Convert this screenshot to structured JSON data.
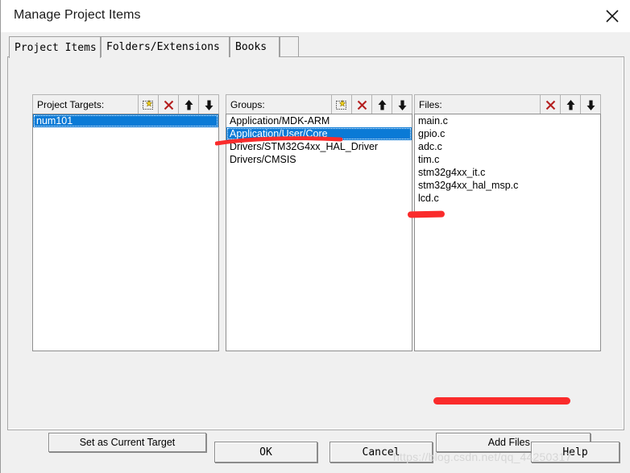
{
  "window": {
    "title": "Manage Project Items",
    "close_icon": "close-icon"
  },
  "tabs": [
    {
      "label": "Project Items",
      "active": true
    },
    {
      "label": "Folders/Extensions",
      "active": false
    },
    {
      "label": "Books",
      "active": false
    }
  ],
  "columns": {
    "targets": {
      "label": "Project Targets:",
      "buttons": [
        "new-item-icon",
        "delete-x-icon",
        "move-up-icon",
        "move-down-icon"
      ],
      "items": [
        {
          "text": "num101",
          "selected": true
        }
      ]
    },
    "groups": {
      "label": "Groups:",
      "buttons": [
        "new-item-icon",
        "delete-x-icon",
        "move-up-icon",
        "move-down-icon"
      ],
      "items": [
        {
          "text": "Application/MDK-ARM",
          "selected": false
        },
        {
          "text": "Application/User/Core",
          "selected": true
        },
        {
          "text": "Drivers/STM32G4xx_HAL_Driver",
          "selected": false
        },
        {
          "text": "Drivers/CMSIS",
          "selected": false
        }
      ]
    },
    "files": {
      "label": "Files:",
      "buttons": [
        "delete-x-icon",
        "move-up-icon",
        "move-down-icon"
      ],
      "items": [
        {
          "text": "main.c",
          "selected": false
        },
        {
          "text": "gpio.c",
          "selected": false
        },
        {
          "text": "adc.c",
          "selected": false
        },
        {
          "text": "tim.c",
          "selected": false
        },
        {
          "text": "stm32g4xx_it.c",
          "selected": false
        },
        {
          "text": "stm32g4xx_hal_msp.c",
          "selected": false
        },
        {
          "text": "lcd.c",
          "selected": false
        }
      ]
    }
  },
  "buttons": {
    "set_as_current_target": "Set as Current Target",
    "add_files": "Add Files...",
    "ok": "OK",
    "cancel": "Cancel",
    "help": "Help"
  },
  "watermark": "https://blog.csdn.net/qq_44250317",
  "colors": {
    "selection_blue": "#0a7ad6",
    "annotation_red": "#fa2b2b",
    "dialog_face": "#f0f0f0",
    "delete_x": "#b52020"
  }
}
